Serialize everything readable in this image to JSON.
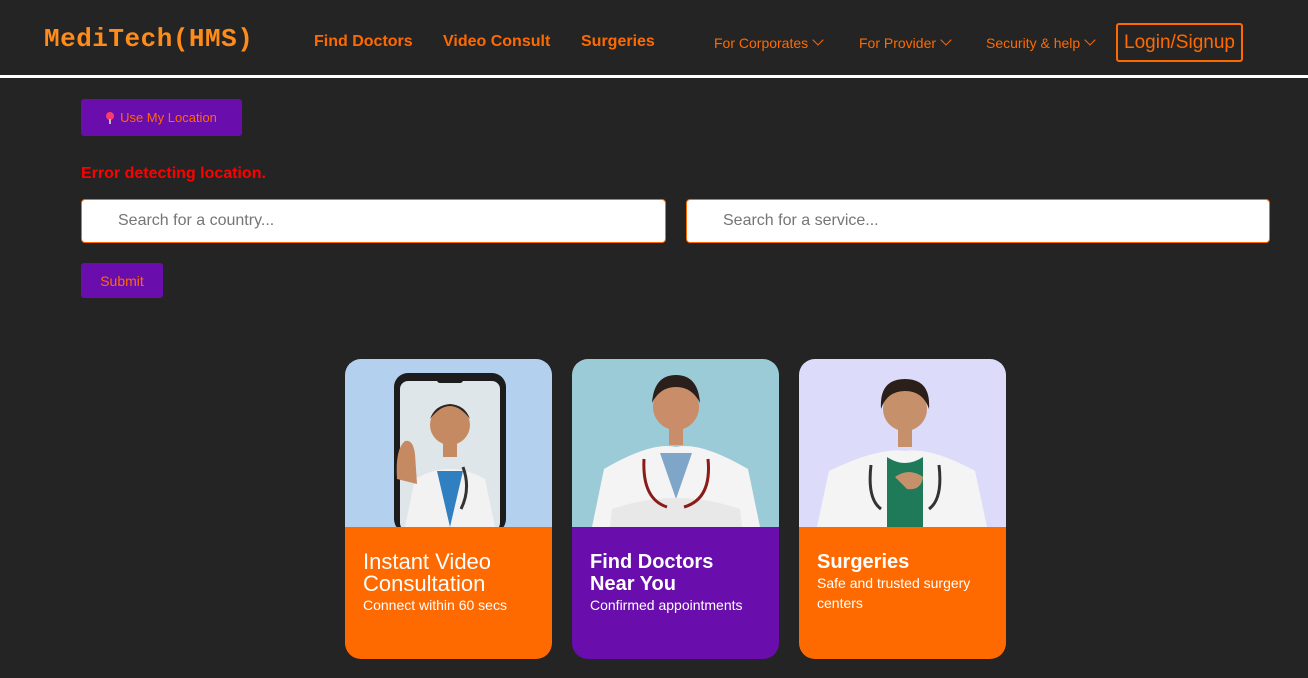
{
  "nav": {
    "brand": "MediTech(HMS)",
    "main_links": [
      "Find Doctors",
      "Video Consult",
      "Surgeries"
    ],
    "dropdowns": [
      "For Corporates",
      "For Provider",
      "Security & help"
    ],
    "login_label": "Login/Signup"
  },
  "location": {
    "button_label": "Use My Location",
    "error": "Error detecting location."
  },
  "search": {
    "country_placeholder": "Search for a country...",
    "service_placeholder": "Search for a service...",
    "submit_label": "Submit"
  },
  "cards": [
    {
      "title": "Instant Video Consultation",
      "subtitle": "Connect within 60 secs"
    },
    {
      "title": "Find Doctors Near You",
      "subtitle": "Confirmed appointments"
    },
    {
      "title": "Surgeries",
      "subtitle": "Safe and trusted surgery centers"
    }
  ],
  "colors": {
    "background": "#242424",
    "accent_orange": "#ff6a00",
    "brand_orange": "#ff8c1a",
    "purple": "#6a0dad",
    "error_red": "#ff0000",
    "card1_image_bg": "#b3d1ef",
    "card2_image_bg": "#9ccbd8",
    "card3_image_bg": "#dcdcfa"
  },
  "icons": [
    "pin-icon",
    "chevron-down-icon"
  ]
}
